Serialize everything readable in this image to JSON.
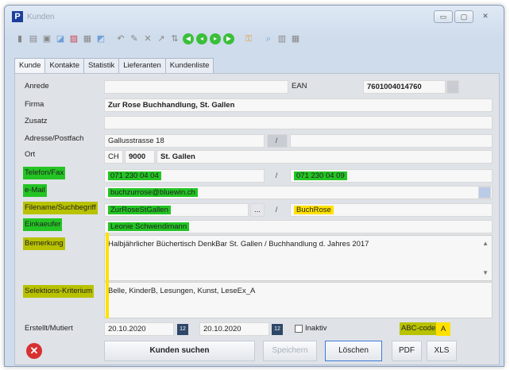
{
  "window": {
    "title": "Kunden",
    "app_icon": "P",
    "buttons": [
      "▭",
      "▢",
      "✕"
    ]
  },
  "toolbar_icons": [
    "save-icon",
    "copy-icon",
    "floppy-icon",
    "page-icon",
    "print-icon",
    "copy2-icon",
    "page2-icon",
    "undo-icon",
    "pencil-icon",
    "delete-icon",
    "edit-icon",
    "refresh-icon",
    "first-icon",
    "prev-icon",
    "next-icon",
    "last-icon",
    "key-icon",
    "search-icon",
    "calculator-icon",
    "grid-icon"
  ],
  "tabs": [
    "Kunde",
    "Kontakte",
    "Statistik",
    "Lieferanten",
    "Kundenliste"
  ],
  "labels": {
    "anrede": "Anrede",
    "firma": "Firma",
    "zusatz": "Zusatz",
    "adresse": "Adresse/Postfach",
    "ort": "Ort",
    "telefon": "Telefon/Fax",
    "email": "e-Mail",
    "filename": "Filename/Suchbegriff",
    "einkaeufer": "Einkaeufer",
    "bemerkung": "Bemerkung",
    "selektion": "Selektions-Kriterium",
    "erstellt": "Erstellt/Mutiert",
    "ean": "EAN",
    "abc": "ABC-code",
    "inaktiv": "Inaktiv"
  },
  "values": {
    "anrede": "",
    "ean": "7601004014760",
    "firma": "Zur Rose Buchhandlung, St. Gallen",
    "zusatz": "",
    "adresse": "Gallusstrasse 18",
    "adresse2": "",
    "land": "CH",
    "plz": "9000",
    "ort": "St. Gallen",
    "telefon": "071 230 04 04",
    "fax": "071 230 04 09",
    "email": "buchzurrose@bluewin.ch",
    "filename": "ZurRoseStGallen",
    "suchbegriff": "BuchRose",
    "einkaeufer": "Leonie Schwendimann",
    "bemerkung": "Halbjährlicher Büchertisch DenkBar St. Gallen / Buchhandlung d. Jahres 2017",
    "selektion": "Belle, KinderB, Lesungen, Kunst, LeseEx_A",
    "erstellt": "20.10.2020",
    "mutiert": "20.10.2020",
    "abc": "A"
  },
  "separators": {
    "slash": "/",
    "dots": "..."
  },
  "buttons": {
    "suchen": "Kunden suchen",
    "speichern": "Speichern",
    "loeschen": "Löschen",
    "pdf": "PDF",
    "xls": "XLS"
  },
  "colors": {
    "highlight_green": "#24c424",
    "highlight_olive": "#b9c200",
    "highlight_yellow": "#ffe100"
  }
}
